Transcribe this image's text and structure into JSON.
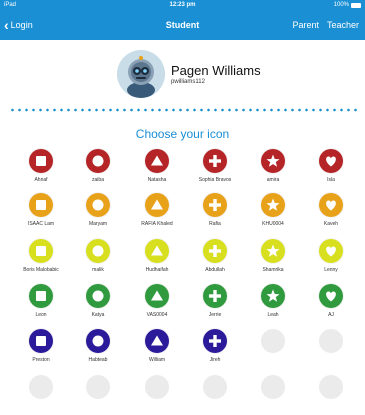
{
  "status_bar": {
    "carrier": "iPad",
    "time": "12:23 pm",
    "battery": "100%"
  },
  "nav": {
    "back_label": "Login",
    "title": "Student",
    "parent_label": "Parent",
    "teacher_label": "Teacher"
  },
  "profile": {
    "name": "Pagen Williams",
    "username": "pwilliams112"
  },
  "heading": "Choose your icon",
  "colors": {
    "accent": "#1a8fd4",
    "red": "#b52426",
    "orange": "#e8a21a",
    "yellow": "#d8df1e",
    "green": "#2f9a3e",
    "blue": "#2b1a9a",
    "empty": "#ebebeb"
  },
  "rows": [
    {
      "color": "red",
      "students": [
        {
          "name": "Ahnaf",
          "shape": "square"
        },
        {
          "name": "zaiba",
          "shape": "circle"
        },
        {
          "name": "Natasha",
          "shape": "triangle"
        },
        {
          "name": "Sophia Bravos",
          "shape": "plus"
        },
        {
          "name": "amira",
          "shape": "star"
        },
        {
          "name": "Isla",
          "shape": "heart"
        }
      ]
    },
    {
      "color": "orange",
      "students": [
        {
          "name": "ISAAC Lam",
          "shape": "square"
        },
        {
          "name": "Maryam",
          "shape": "circle"
        },
        {
          "name": "RAFIA Khaled",
          "shape": "triangle"
        },
        {
          "name": "Rafia",
          "shape": "plus"
        },
        {
          "name": "KHU0004",
          "shape": "star"
        },
        {
          "name": "Kaveh",
          "shape": "heart"
        }
      ]
    },
    {
      "color": "yellow",
      "students": [
        {
          "name": "Boris Malobabic",
          "shape": "square"
        },
        {
          "name": "malik",
          "shape": "circle"
        },
        {
          "name": "Hudhaifah",
          "shape": "triangle"
        },
        {
          "name": "Abdullah",
          "shape": "plus"
        },
        {
          "name": "Shamrika",
          "shape": "star"
        },
        {
          "name": "Lenny",
          "shape": "heart"
        }
      ]
    },
    {
      "color": "green",
      "students": [
        {
          "name": "Leon",
          "shape": "square"
        },
        {
          "name": "Katya",
          "shape": "circle"
        },
        {
          "name": "VAS0004",
          "shape": "triangle"
        },
        {
          "name": "Jerrie",
          "shape": "plus"
        },
        {
          "name": "Leah",
          "shape": "star"
        },
        {
          "name": "AJ",
          "shape": "heart"
        }
      ]
    },
    {
      "color": "blue",
      "students": [
        {
          "name": "Preston",
          "shape": "square"
        },
        {
          "name": "Habteab",
          "shape": "circle"
        },
        {
          "name": "William",
          "shape": "triangle"
        },
        {
          "name": "Jireh",
          "shape": "plus"
        },
        {
          "name": "",
          "shape": "empty"
        },
        {
          "name": "",
          "shape": "empty"
        }
      ]
    },
    {
      "color": "empty",
      "students": [
        {
          "name": "",
          "shape": "empty"
        },
        {
          "name": "",
          "shape": "empty"
        },
        {
          "name": "",
          "shape": "empty"
        },
        {
          "name": "",
          "shape": "empty"
        },
        {
          "name": "",
          "shape": "empty"
        },
        {
          "name": "",
          "shape": "empty"
        }
      ]
    }
  ]
}
